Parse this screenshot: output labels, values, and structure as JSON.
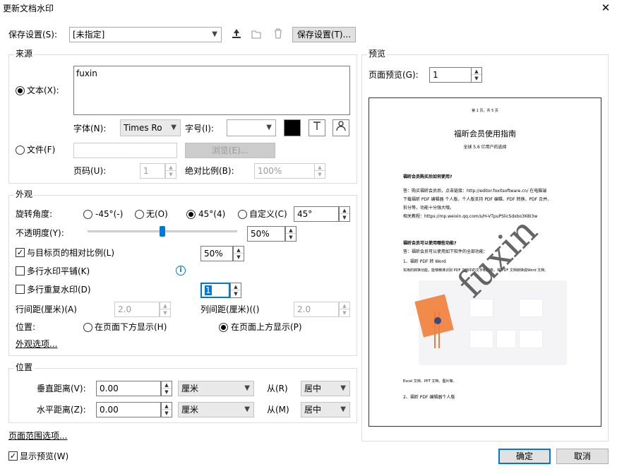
{
  "window": {
    "title": "更新文档水印",
    "close": "✕"
  },
  "save": {
    "label": "保存设置(S):",
    "value": "[未指定]",
    "button": "保存设置(T)..."
  },
  "source": {
    "title": "来源",
    "text_label": "文本(X):",
    "text_value": "fuxin",
    "font_label": "字体(N):",
    "font_value": "Times Ro",
    "size_label": "字号(I):",
    "size_value": "",
    "file_label": "文件(F)",
    "browse": "浏览(E)...",
    "page_label": "页码(U):",
    "page_value": "1",
    "scale_label": "绝对比例(B):",
    "scale_value": "100%"
  },
  "appearance": {
    "title": "外观",
    "rotation_label": "旋转角度:",
    "rot_m45": "-45°(-)",
    "rot_none": "无(O)",
    "rot_45": "45°(4)",
    "rot_custom": "自定义(C)",
    "rot_value": "45°",
    "opacity_label": "不透明度(Y):",
    "opacity_value": "50%",
    "opacity_level": 0.5,
    "relative_label": "与目标页的相对比例(L)",
    "relative_value": "50%",
    "tile_label": "多行水印平铺(K)",
    "repeat_label": "多行重复水印(D)",
    "repeat_value": "1",
    "row_gap_label": "行间距(厘米)(A)",
    "row_gap_value": "2.0",
    "col_gap_label": "列间距(厘米)(()",
    "col_gap_value": "2.0",
    "position_label": "位置:",
    "below_label": "在页面下方显示(H)",
    "above_label": "在页面上方显示(P)",
    "options_link": "外观选项..."
  },
  "position": {
    "title": "位置",
    "v_label": "垂直距离(V):",
    "v_value": "0.00",
    "v_unit": "厘米",
    "v_from_label": "从(R)",
    "v_from": "居中",
    "h_label": "水平距离(Z):",
    "h_value": "0.00",
    "h_unit": "厘米",
    "h_from_label": "从(M)",
    "h_from": "居中"
  },
  "page_range_link": "页面范围选项...",
  "show_preview": "显示预览(W)",
  "preview": {
    "title": "预览",
    "page_label": "页面预览(G):",
    "page_value": "1",
    "doc": {
      "header": "第 1 页，共 5 页",
      "title": "福昕会员使用指南",
      "subtitle": "全球 5.6 亿用户的选择",
      "q1": "福昕会员购买后如何使用?",
      "a1_1": "答：购买福昕会员后，点击链接：http://editor.foxitsoftware.cn/ 在电脑端",
      "a1_2": "下载福昕 PDF 编辑器 个人版，个人版支持 PDF 编辑、PDF 转换、PDF 合并、",
      "a1_3": "拆分等，功能十分强大哦。",
      "a1_4": "相关教程：https://mp.weixin.qq.com/s/H-VTpuPSlicSdxbo3K8I3w",
      "q2": "福昕会员可以使用哪些功能?",
      "a2_1": "答：福昕会员可以使用如下软件的全部功能：",
      "a2_2": "1、福昕 PDF 转 Word",
      "a2_3": "实用的转换功能，能够精准识别 PDF 文档中的文字和图像，将 PDF 文档转换成Word 文档、",
      "a2_4": "Excel 文档、PPT 文档、图片等。",
      "a2_5": "2、福昕 PDF 编辑器个人版",
      "watermark": "fuxin"
    }
  },
  "buttons": {
    "ok": "确定",
    "cancel": "取消"
  }
}
